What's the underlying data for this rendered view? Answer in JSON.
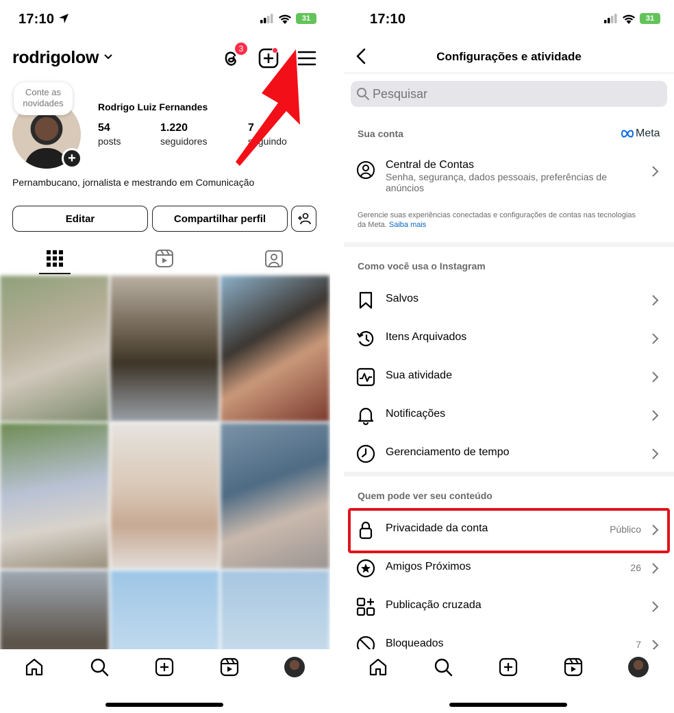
{
  "left": {
    "status": {
      "time": "17:10",
      "battery": "31"
    },
    "header": {
      "username": "rodrigolow",
      "threads_badge": "3"
    },
    "note": {
      "text": "Conte as novidades"
    },
    "profile": {
      "full_name": "Rodrigo Luiz Fernandes",
      "stats": [
        {
          "value": "54",
          "label": "posts"
        },
        {
          "value": "1.220",
          "label": "seguidores"
        },
        {
          "value": "7",
          "label": "seguindo"
        }
      ],
      "bio": "Pernambucano, jornalista e mestrando em Comunicação"
    },
    "buttons": {
      "edit": "Editar",
      "share": "Compartilhar perfil"
    },
    "tabs": [
      "grid-icon",
      "reels-icon",
      "tagged-icon"
    ],
    "bottom_nav": [
      "home-icon",
      "search-icon",
      "create-icon",
      "reels-icon",
      "profile-avatar"
    ]
  },
  "right": {
    "status": {
      "time": "17:10",
      "battery": "31"
    },
    "title": "Configurações e atividade",
    "search": {
      "placeholder": "Pesquisar"
    },
    "your_account": {
      "section": "Sua conta",
      "meta_logo": "Meta",
      "accounts_center": {
        "label": "Central de Contas",
        "subtitle": "Senha, segurança, dados pessoais, preferências de anúncios"
      },
      "note": "Gerencie suas experiências conectadas e configurações de contas nas tecnologias da Meta.",
      "note_link": "Saiba mais"
    },
    "how_you_use": {
      "section": "Como você usa o Instagram",
      "items": [
        {
          "label": "Salvos",
          "icon": "bookmark-icon"
        },
        {
          "label": "Itens Arquivados",
          "icon": "archive-icon"
        },
        {
          "label": "Sua atividade",
          "icon": "activity-icon"
        },
        {
          "label": "Notificações",
          "icon": "bell-icon"
        },
        {
          "label": "Gerenciamento de tempo",
          "icon": "clock-icon"
        }
      ]
    },
    "who_can_see": {
      "section": "Quem pode ver seu conteúdo",
      "items": [
        {
          "label": "Privacidade da conta",
          "value": "Público",
          "icon": "lock-icon"
        },
        {
          "label": "Amigos Próximos",
          "value": "26",
          "icon": "star-icon"
        },
        {
          "label": "Publicação cruzada",
          "value": "",
          "icon": "crosspost-icon"
        },
        {
          "label": "Bloqueados",
          "value": "7",
          "icon": "blocked-icon"
        }
      ]
    },
    "bottom_nav": [
      "home-icon",
      "search-icon",
      "create-icon",
      "reels-icon",
      "profile-avatar"
    ]
  },
  "colors": {
    "accent_red": "#e0141c",
    "link_blue": "#0a66c2",
    "badge_red": "#ff2d4a"
  }
}
